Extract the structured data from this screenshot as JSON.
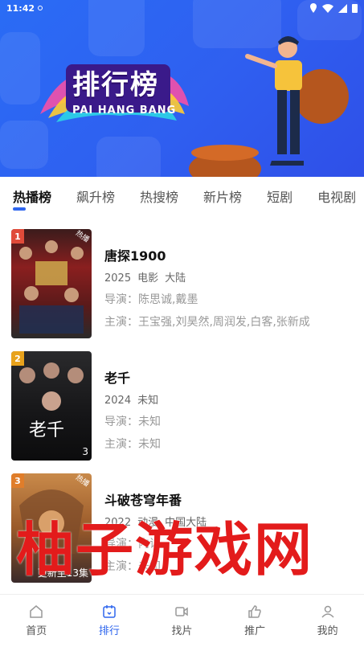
{
  "status_bar": {
    "time": "11:42"
  },
  "banner": {
    "title": "排行榜",
    "subtitle": "PAI HANG BANG"
  },
  "tabs": [
    {
      "label": "热播榜",
      "active": true
    },
    {
      "label": "飙升榜",
      "active": false
    },
    {
      "label": "热搜榜",
      "active": false
    },
    {
      "label": "新片榜",
      "active": false
    },
    {
      "label": "短剧",
      "active": false
    },
    {
      "label": "电视剧",
      "active": false
    }
  ],
  "list": [
    {
      "rank": "1",
      "corner": "热播",
      "episode": "",
      "title": "唐探1900",
      "year": "2025",
      "type": "电影",
      "region": "大陆",
      "director_label": "导演：",
      "director": "陈思诚,戴墨",
      "cast_label": "主演：",
      "cast": "王宝强,刘昊然,周润发,白客,张新成",
      "poster_color": "#7a1a1a",
      "rank_color": "#e04b3a"
    },
    {
      "rank": "2",
      "corner": "",
      "episode": "3",
      "title": "老千",
      "year": "2024",
      "type": "未知",
      "region": "",
      "director_label": "导演：",
      "director": "未知",
      "cast_label": "主演：",
      "cast": "未知",
      "poster_color": "#1c1c1e",
      "rank_color": "#e8a21c"
    },
    {
      "rank": "3",
      "corner": "热播",
      "episode": "更新至13集",
      "title": "斗破苍穹年番",
      "year": "2022",
      "type": "动漫",
      "region": "中国大陆",
      "director_label": "导演：",
      "director": "内详",
      "cast_label": "主演：",
      "cast": "未知",
      "poster_color": "#b3682a",
      "rank_color": "#e07d2a"
    }
  ],
  "watermark": "柚子游戏网",
  "bottom_nav": [
    {
      "label": "首页",
      "icon": "home-icon",
      "active": false
    },
    {
      "label": "排行",
      "icon": "ranking-icon",
      "active": true
    },
    {
      "label": "找片",
      "icon": "video-icon",
      "active": false
    },
    {
      "label": "推广",
      "icon": "thumb-up-icon",
      "active": false
    },
    {
      "label": "我的",
      "icon": "user-icon",
      "active": false
    }
  ],
  "colors": {
    "accent": "#2f66ee",
    "banner": "#2f5ff0",
    "watermark": "#e31b1b"
  }
}
